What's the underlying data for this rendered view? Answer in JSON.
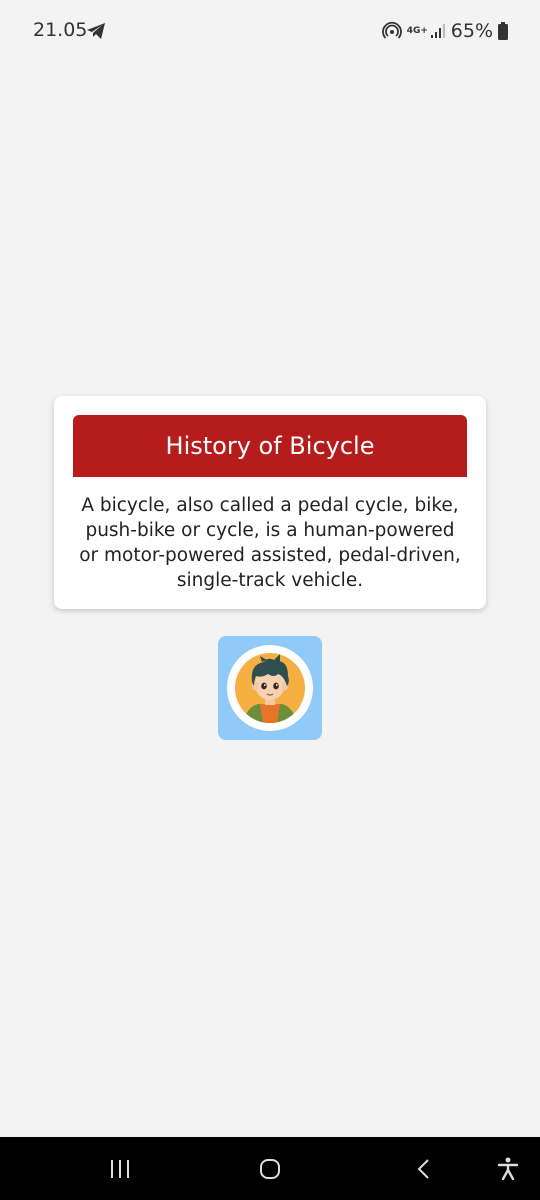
{
  "status_bar": {
    "time": "21.05",
    "network_type": "4G+",
    "battery": "65%"
  },
  "card": {
    "title": "History of Bicycle",
    "description": "A bicycle, also called a pedal cycle, bike, push-bike or cycle, is a human-powered or motor-powered assisted, pedal-driven, single-track vehicle."
  },
  "avatar": {
    "icon": "cartoon-boy-avatar",
    "background_color": "#90caf9"
  },
  "nav_bar": {
    "buttons": [
      "recent-apps-icon",
      "home-icon",
      "back-icon",
      "accessibility-icon"
    ]
  },
  "colors": {
    "header": "#b71c1c",
    "background": "#f3f3f3"
  }
}
